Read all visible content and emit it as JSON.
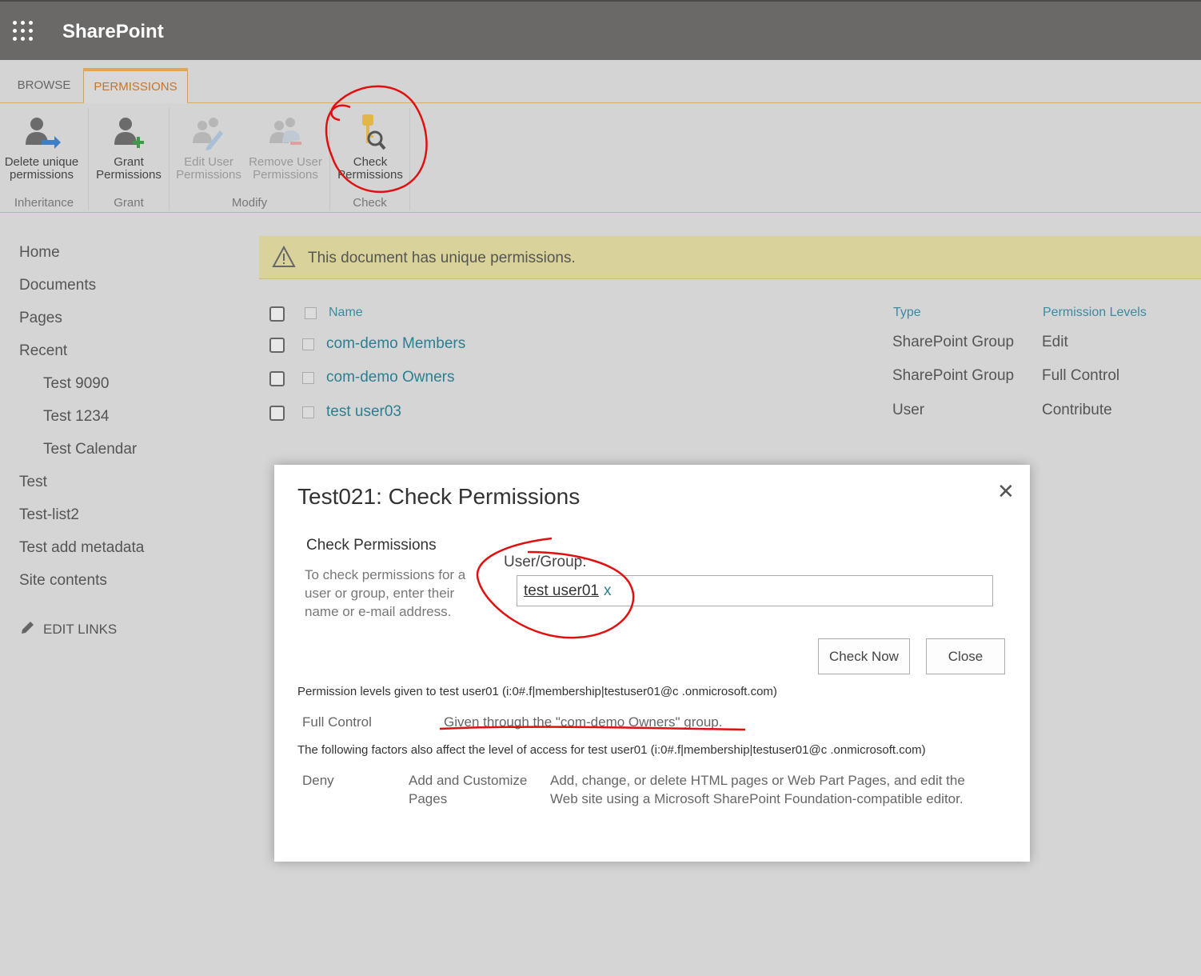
{
  "suite": {
    "brand": "SharePoint",
    "waffle_icon": "app-launcher-icon"
  },
  "ribbon": {
    "tabs": [
      {
        "label": "BROWSE",
        "active": false
      },
      {
        "label": "PERMISSIONS",
        "active": true
      }
    ],
    "buttons": {
      "delete_unique": {
        "line1": "Delete unique",
        "line2": "permissions"
      },
      "grant": {
        "line1": "Grant",
        "line2": "Permissions"
      },
      "edit_user": {
        "line1": "Edit User",
        "line2": "Permissions"
      },
      "remove_user": {
        "line1": "Remove User",
        "line2": "Permissions"
      },
      "check": {
        "line1": "Check",
        "line2": "Permissions"
      }
    },
    "groups": {
      "inheritance": "Inheritance",
      "grant": "Grant",
      "modify": "Modify",
      "check": "Check"
    }
  },
  "nav": {
    "items": [
      {
        "label": "Home"
      },
      {
        "label": "Documents"
      },
      {
        "label": "Pages"
      },
      {
        "label": "Recent"
      },
      {
        "label": "Test 9090"
      },
      {
        "label": "Test 1234"
      },
      {
        "label": "Test Calendar"
      },
      {
        "label": "Test"
      },
      {
        "label": "Test-list2"
      },
      {
        "label": "Test add metadata"
      },
      {
        "label": "Site contents"
      }
    ],
    "edit_links": "EDIT LINKS"
  },
  "banner": {
    "text": "This document has unique permissions."
  },
  "table": {
    "headers": {
      "name": "Name",
      "type": "Type",
      "levels": "Permission Levels"
    },
    "rows": [
      {
        "name": "com-demo Members",
        "type": "SharePoint Group",
        "level": "Edit"
      },
      {
        "name": "com-demo Owners",
        "type": "SharePoint Group",
        "level": "Full Control"
      },
      {
        "name": "test user03",
        "type": "User",
        "level": "Contribute"
      }
    ]
  },
  "dialog": {
    "title": "Test021: Check Permissions",
    "section_heading": "Check Permissions",
    "section_desc": "To check permissions for a user or group, enter their name or e-mail address.",
    "user_group_label": "User/Group:",
    "user_group_value": "test user01",
    "remove_label": "x",
    "check_now": "Check Now",
    "close": "Close",
    "result_heading": "Permission levels given to test user01 (i:0#.f|membership|testuser01@c        .onmicrosoft.com)",
    "result_level": "Full Control",
    "result_reason": "Given through the \"com-demo Owners\" group.",
    "factors_heading": "The following factors also affect the level of access for test user01 (i:0#.f|membership|testuser01@c        .onmicrosoft.com)",
    "deny_label": "Deny",
    "deny_permission": "Add and Customize Pages",
    "deny_desc": "Add, change, or delete HTML pages or Web Part Pages, and edit the Web site using a Microsoft SharePoint Foundation-compatible editor."
  },
  "colors": {
    "suitebar": "#6b6967",
    "accent_tab": "#c7752a",
    "link": "#2a7f92",
    "banner": "#d9d29b",
    "annotation": "#e01010"
  }
}
